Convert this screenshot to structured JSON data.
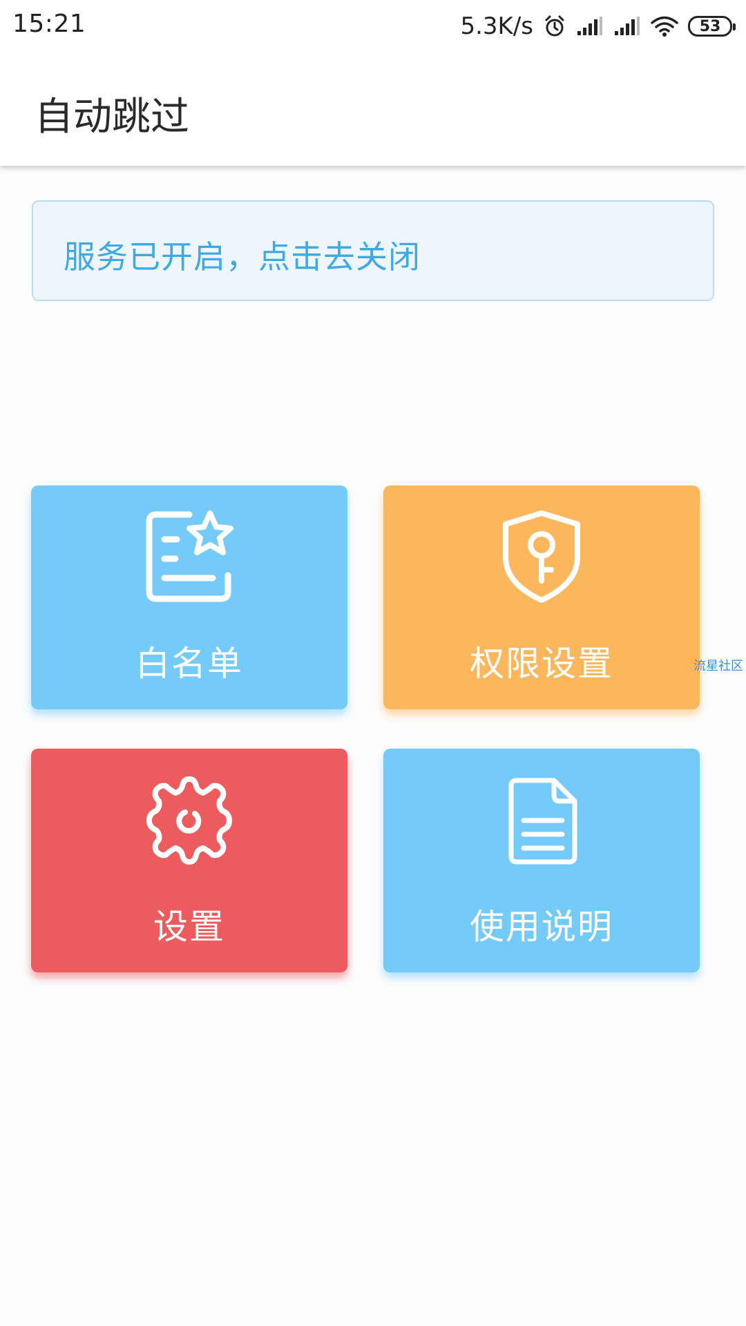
{
  "status_bar": {
    "time": "15:21",
    "net_speed": "5.3K/s",
    "battery": "53",
    "icons": [
      "alarm-icon",
      "signal-icon",
      "signal-icon",
      "wifi-icon",
      "battery-icon"
    ]
  },
  "app_bar": {
    "title": "自动跳过"
  },
  "service_banner": {
    "text": "服务已开启，点击去关闭"
  },
  "tiles": [
    {
      "label": "白名单",
      "icon": "whitelist-icon",
      "color": "#74cbfa"
    },
    {
      "label": "权限设置",
      "icon": "shield-key-icon",
      "color": "#fcb65c"
    },
    {
      "label": "设置",
      "icon": "gear-icon",
      "color": "#ec5b5e"
    },
    {
      "label": "使用说明",
      "icon": "document-icon",
      "color": "#74cbfa"
    }
  ],
  "watermark": "流星社区",
  "colors": {
    "banner_bg": "#eef6fc",
    "banner_border": "#b9dcf4",
    "banner_text": "#3fa9e6"
  }
}
